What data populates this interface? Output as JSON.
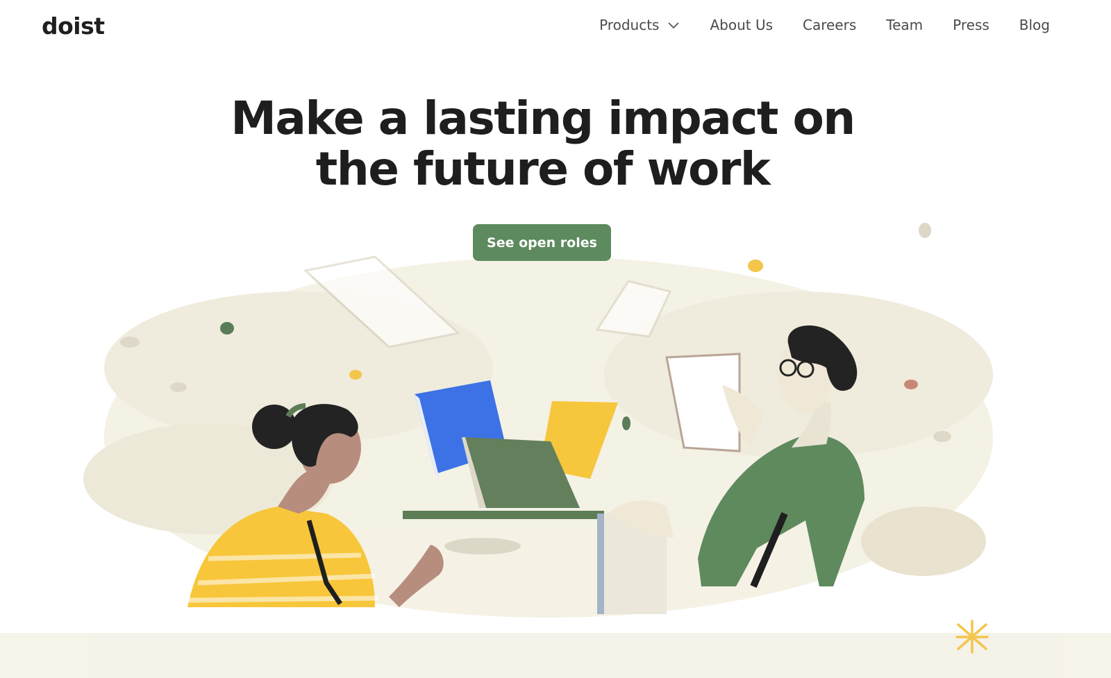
{
  "header": {
    "logo": "doist",
    "nav": [
      {
        "label": "Products",
        "has_dropdown": true
      },
      {
        "label": "About Us"
      },
      {
        "label": "Careers"
      },
      {
        "label": "Team"
      },
      {
        "label": "Press"
      },
      {
        "label": "Blog"
      }
    ]
  },
  "hero": {
    "title_line1": "Make a lasting impact on",
    "title_line2": "the future of work",
    "cta_label": "See open roles"
  },
  "colors": {
    "accent_green": "#5d8a5e",
    "book_blue": "#3d72e6",
    "yellow": "#f8c63a",
    "wash": "#f3f0e3"
  },
  "illustration": {
    "icons": [
      "woman-figure",
      "man-figure",
      "books-icon",
      "sparkle-icon"
    ]
  }
}
